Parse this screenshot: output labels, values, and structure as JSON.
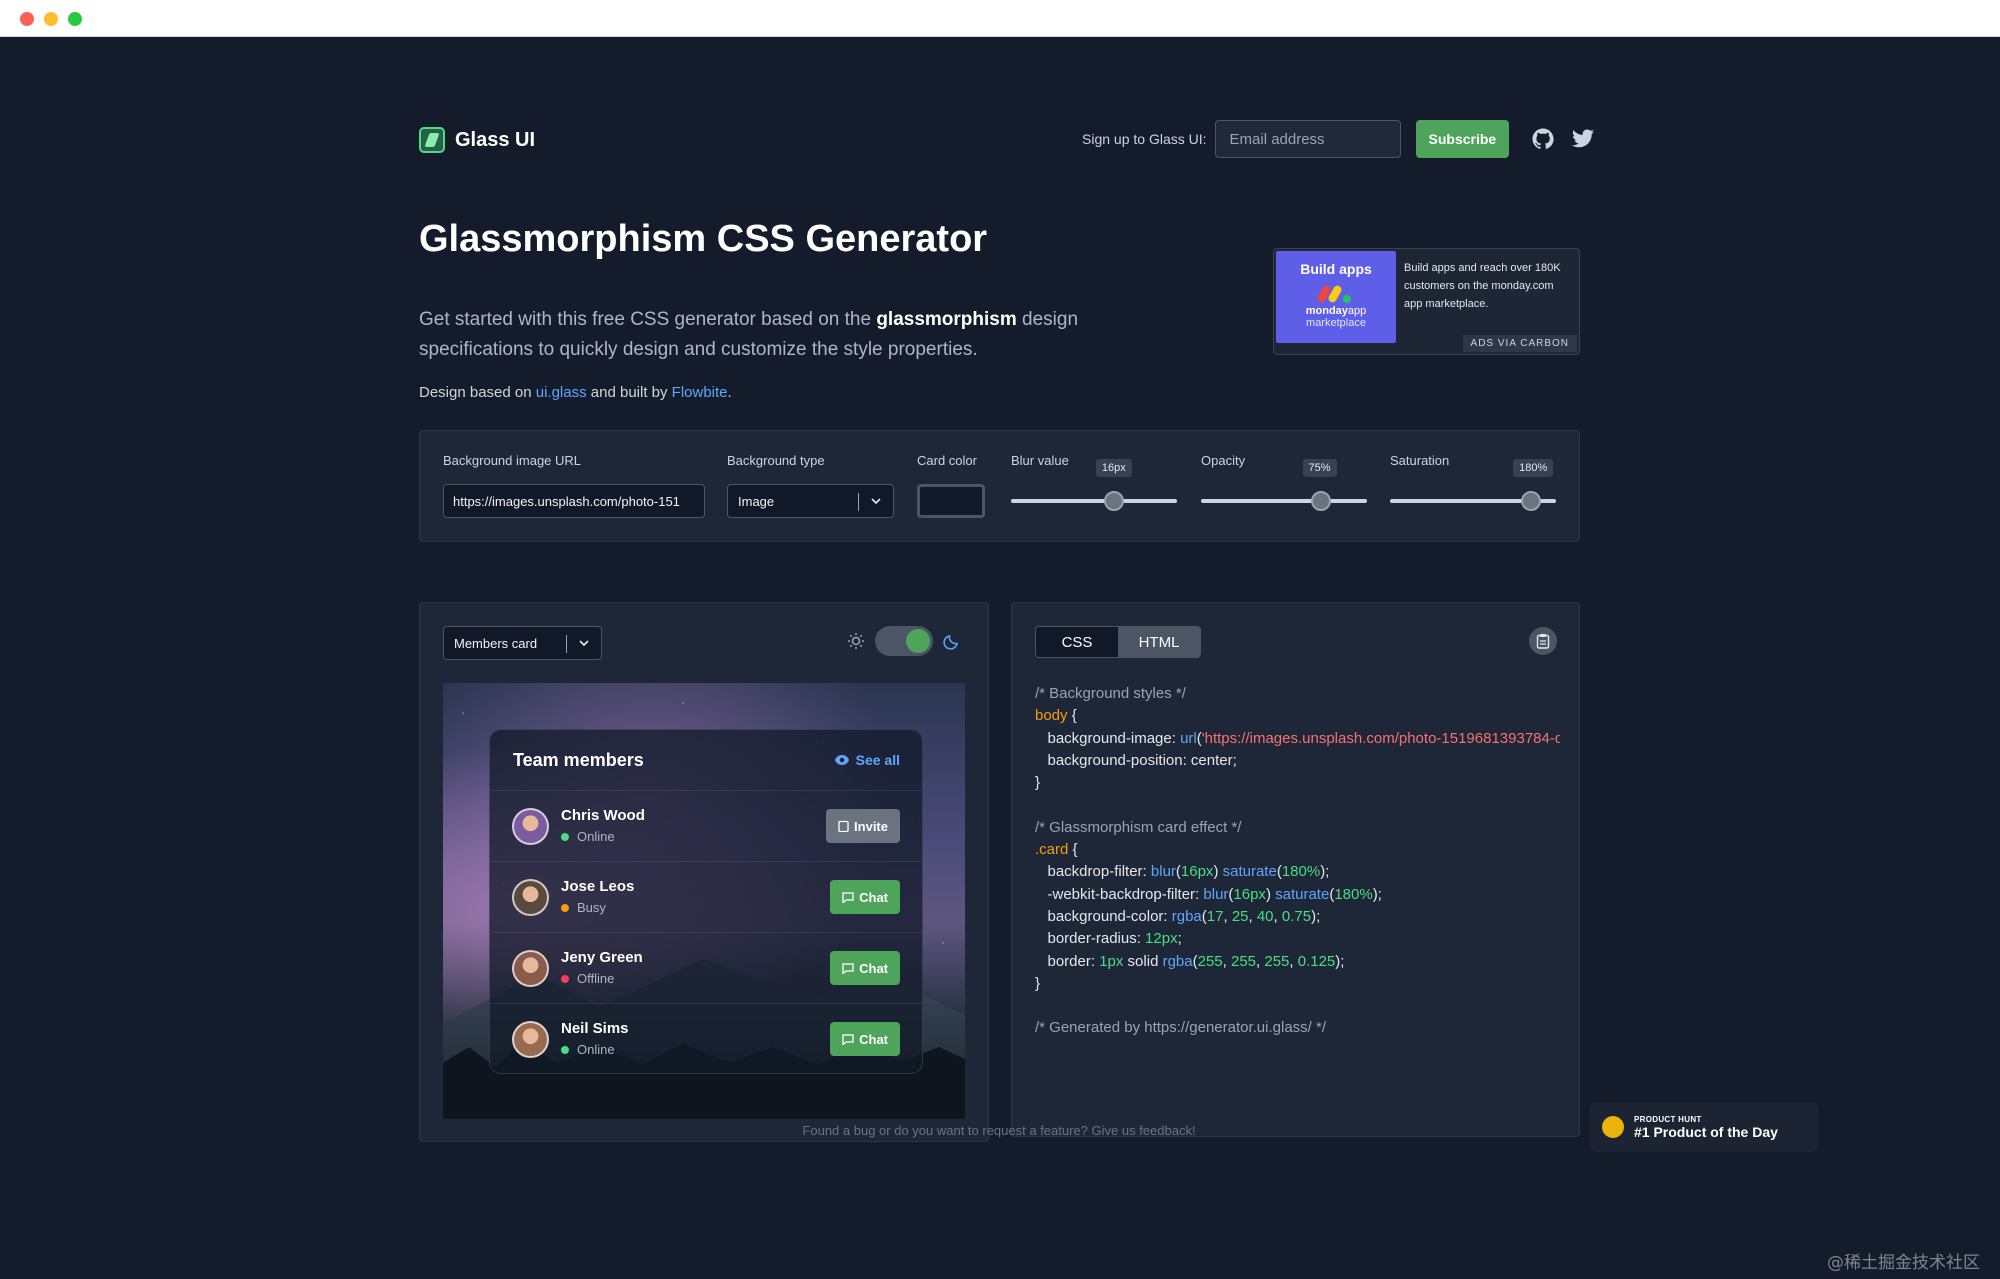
{
  "header": {
    "logo_text": "Glass UI",
    "signup_label": "Sign up to Glass UI:",
    "email_placeholder": "Email address",
    "subscribe_label": "Subscribe"
  },
  "hero": {
    "title": "Glassmorphism CSS Generator",
    "desc_part1": "Get started with this free CSS generator based on the ",
    "desc_bold": "glassmorphism",
    "desc_part2": " design specifications to quickly design and customize the style properties.",
    "credit_part1": "Design based on ",
    "credit_link1": "ui.glass",
    "credit_part2": " and built by ",
    "credit_link2": "Flowbite",
    "credit_part3": "."
  },
  "ad": {
    "img_title": "Build apps",
    "img_brand": "monday",
    "img_brand_suffix": "app",
    "img_sub": "marketplace",
    "text": "Build apps and reach over 180K customers on the monday.com app marketplace.",
    "via": "ADS VIA CARBON"
  },
  "controls": {
    "bg_url_label": "Background image URL",
    "bg_url_value": "https://images.unsplash.com/photo-151",
    "bg_type_label": "Background type",
    "bg_type_value": "Image",
    "card_color_label": "Card color",
    "card_color_value": "#111a2b",
    "blur_label": "Blur value",
    "blur_tip": "16px",
    "blur_level": 0.62,
    "opacity_label": "Opacity",
    "opacity_tip": "75%",
    "opacity_level": 0.72,
    "saturation_label": "Saturation",
    "saturation_tip": "180%",
    "saturation_level": 0.85
  },
  "preview": {
    "component_select": "Members card",
    "theme": "dark",
    "card": {
      "title": "Team members",
      "see_all": "See all",
      "members": [
        {
          "name": "Chris Wood",
          "status": "Online",
          "status_color": "#4ade80",
          "action": "Invite",
          "avatar_color": "#7c5c9e"
        },
        {
          "name": "Jose Leos",
          "status": "Busy",
          "status_color": "#f59e0b",
          "action": "Chat",
          "avatar_color": "#5a4a3e"
        },
        {
          "name": "Jeny Green",
          "status": "Offline",
          "status_color": "#f43f5e",
          "action": "Chat",
          "avatar_color": "#8a5a4a"
        },
        {
          "name": "Neil Sims",
          "status": "Online",
          "status_color": "#4ade80",
          "action": "Chat",
          "avatar_color": "#9a6a50"
        }
      ]
    }
  },
  "code": {
    "tab_css": "CSS",
    "tab_html": "HTML",
    "active_tab": "CSS"
  },
  "footer": {
    "feedback": "Found a bug or do you want to request a feature? Give us feedback!",
    "ph_small": "PRODUCT HUNT",
    "ph_big": "#1 Product of the Day",
    "watermark": "@稀土掘金技术社区"
  },
  "colors": {
    "accent_green": "#4ea45a",
    "link_blue": "#60a5fa",
    "page_bg": "#141c2c"
  }
}
